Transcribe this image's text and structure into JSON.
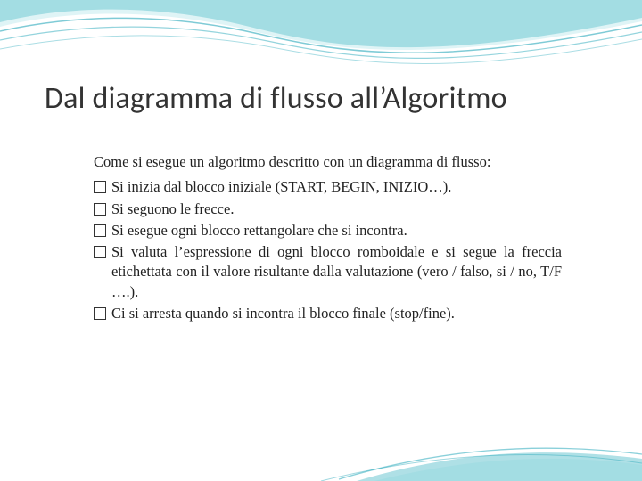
{
  "title": "Dal diagramma di flusso all’Algoritmo",
  "intro": "Come si esegue un algoritmo descritto con un diagramma di flusso:",
  "bullets": [
    "Si inizia dal blocco iniziale (START, BEGIN, INIZIO…).",
    "Si seguono le frecce.",
    "Si esegue ogni blocco rettangolare che si incontra.",
    "Si valuta l’espressione di ogni blocco romboidale e si segue la freccia etichettata con il valore risultante dalla valutazione (vero / falso, si / no, T/F ….).",
    "Ci si arresta quando si incontra il blocco finale (stop/fine)."
  ]
}
